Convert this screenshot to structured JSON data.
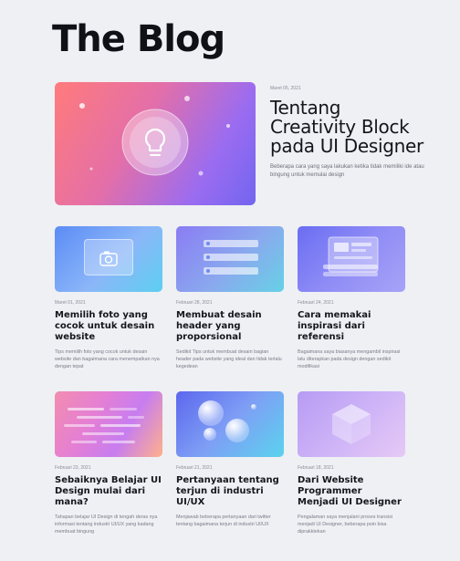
{
  "page": {
    "title": "The Blog"
  },
  "featured": {
    "date": "Maret 05, 2021",
    "title": "Tentang Creativity Block pada UI Designer",
    "description": "Beberapa cara yang saya lakukan ketika tidak memiliki ide atau bingung untuk memulai design",
    "illustration": "lightbulb-icon"
  },
  "posts": [
    {
      "date": "Maret 01, 2021",
      "title": "Memilih foto yang cocok untuk desain website",
      "description": "Tips memilih foto yang cocok untuk desain website dan bagaimana cara menempatkan nya dengan tepat",
      "illustration": "camera-icon"
    },
    {
      "date": "Februari 28, 2021",
      "title": "Membuat desain header yang proporsional",
      "description": "Sedikit Tips untuk membuat desain bagian header pada website yang ideal dan tidak terlalu kegedean",
      "illustration": "header-bars-icon"
    },
    {
      "date": "Februari 24, 2021",
      "title": "Cara memakai inspirasi dari referensi",
      "description": "Bagaimana saya biasanya mengambil inspirasi lalu diterapkan pada design dengan sedikit modifikasi",
      "illustration": "layout-icon"
    },
    {
      "date": "Februari 23, 2021",
      "title": "Sebaiknya Belajar UI Design mulai dari mana?",
      "description": "Tahapan belajar UI Design di tengah deras nya informasi tentang industri UI/UX yang kadang membuat bingung",
      "illustration": "speed-lines-icon"
    },
    {
      "date": "Februari 21, 2021",
      "title": "Pertanyaan tentang terjun di industri UI/UX",
      "description": "Menjawab beberapa pertanyaan dari twitter tentang bagaimana terjun di industri UI/UX",
      "illustration": "bubbles-icon"
    },
    {
      "date": "Februari 18, 2021",
      "title": "Dari Website Programmer Menjadi UI Designer",
      "description": "Pengalaman saya menjalani proses transisi menjadi UI Designer, beberapa poin bisa diprakktekan",
      "illustration": "cube-icon"
    }
  ]
}
